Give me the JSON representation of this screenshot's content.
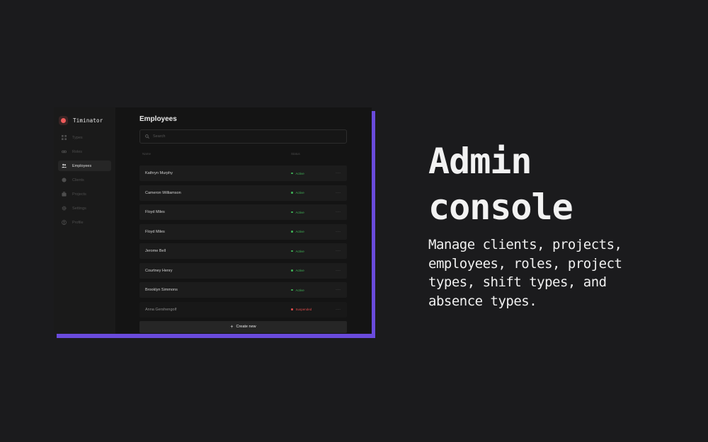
{
  "app": {
    "brand": "Timinator",
    "accent_color": "#6a4bdc",
    "logo_color": "#ef5b5b"
  },
  "sidebar": {
    "items": [
      {
        "label": "Types",
        "icon": "grid-icon",
        "active": false
      },
      {
        "label": "Roles",
        "icon": "link-icon",
        "active": false
      },
      {
        "label": "Employees",
        "icon": "users-icon",
        "active": true
      },
      {
        "label": "Clients",
        "icon": "globe-icon",
        "active": false
      },
      {
        "label": "Projects",
        "icon": "briefcase-icon",
        "active": false
      },
      {
        "label": "Settings",
        "icon": "gear-icon",
        "active": false
      },
      {
        "label": "Profile",
        "icon": "user-circle-icon",
        "active": false
      }
    ]
  },
  "main": {
    "title": "Employees",
    "search_placeholder": "Search",
    "columns": [
      "Name",
      "Status"
    ],
    "rows": [
      {
        "name": "Kathryn Murphy",
        "status": "Active",
        "more": "···"
      },
      {
        "name": "Cameron Williamson",
        "status": "Active",
        "more": "···"
      },
      {
        "name": "Floyd Miles",
        "status": "Active",
        "more": "···"
      },
      {
        "name": "Floyd Miles",
        "status": "Active",
        "more": "···"
      },
      {
        "name": "Jerome Bell",
        "status": "Active",
        "more": "···"
      },
      {
        "name": "Courtney Henry",
        "status": "Active",
        "more": "···"
      },
      {
        "name": "Brooklyn Simmons",
        "status": "Active",
        "more": "···"
      },
      {
        "name": "Anna Gershengolf",
        "status": "Suspended",
        "more": "···"
      }
    ],
    "create_label": "Create new",
    "status_colors": {
      "Active": "#3fae55",
      "Suspended": "#d84a4a"
    }
  },
  "promo": {
    "headline": "Admin console",
    "description": "Manage clients, projects, employees, roles, project types, shift types, and absence types."
  }
}
